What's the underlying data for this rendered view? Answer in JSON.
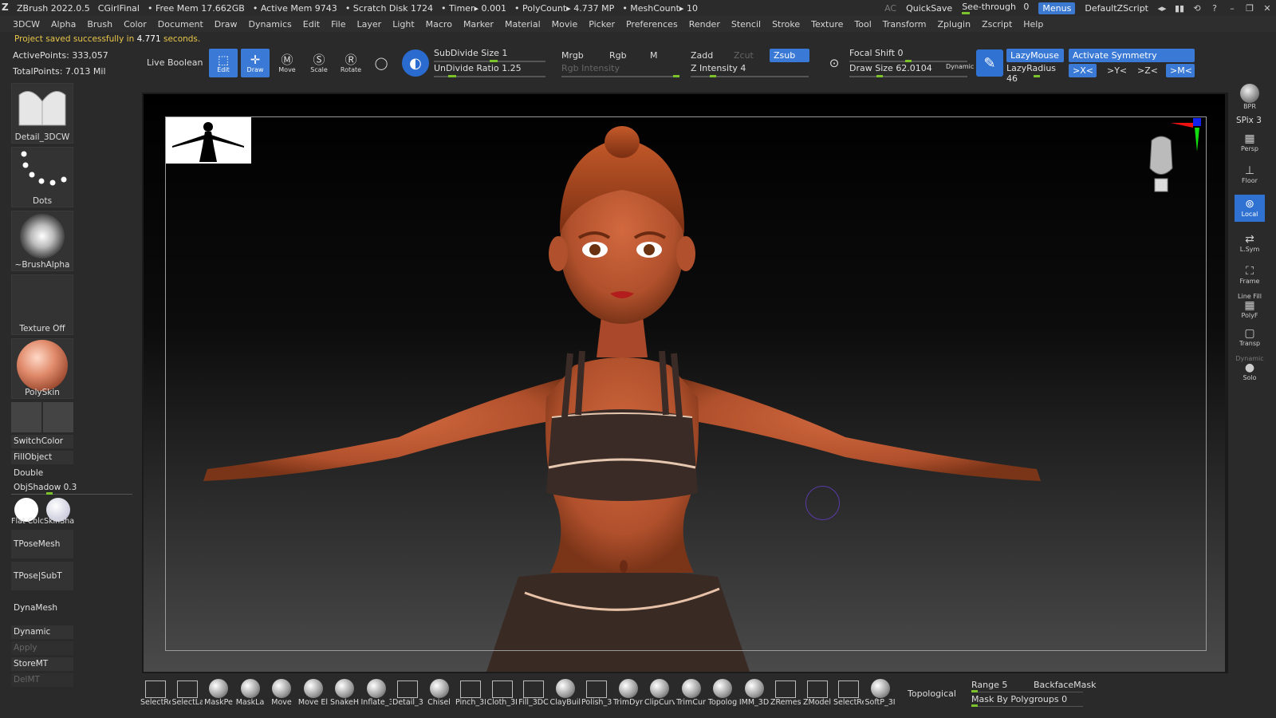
{
  "titlebar": {
    "app": "ZBrush 2022.0.5",
    "project": "CGirlFinal",
    "free_mem": "• Free Mem 17.662GB",
    "active_mem": "• Active Mem 9743",
    "scratch": "• Scratch Disk 1724",
    "timer": "• Timer▸ 0.001",
    "polycount": "• PolyCount▸ 4.737 MP",
    "meshcount": "• MeshCount▸ 10",
    "ac": "AC",
    "quicksave": "QuickSave",
    "see_through_label": "See-through",
    "see_through_value": "0",
    "menus": "Menus",
    "script": "DefaultZScript"
  },
  "menubar": [
    "3DCW",
    "Alpha",
    "Brush",
    "Color",
    "Document",
    "Draw",
    "Dynamics",
    "Edit",
    "File",
    "Layer",
    "Light",
    "Macro",
    "Marker",
    "Material",
    "Movie",
    "Picker",
    "Preferences",
    "Render",
    "Stencil",
    "Stroke",
    "Texture",
    "Tool",
    "Transform",
    "Zplugin",
    "Zscript",
    "Help"
  ],
  "notice": {
    "prefix": "Project saved successfully in",
    "value": "4.771",
    "suffix": "seconds."
  },
  "stats": {
    "active_points": "ActivePoints: 333,057",
    "total_points": "TotalPoints: 7.013 Mil"
  },
  "shelf": {
    "live_boolean": "Live Boolean",
    "edit": "Edit",
    "draw": "Draw",
    "move": "Move",
    "scale": "Scale",
    "rotate": "Rotate",
    "subdivide_label": "SubDivide Size",
    "subdivide_value": "1",
    "undivide_label": "UnDivide Ratio",
    "undivide_value": "1.25",
    "mrgb": "Mrgb",
    "rgb": "Rgb",
    "m": "M",
    "rgb_intensity": "Rgb Intensity",
    "zadd": "Zadd",
    "zcut": "Zcut",
    "zsub": "Zsub",
    "z_intensity_label": "Z Intensity",
    "z_intensity_value": "4",
    "focal_shift_label": "Focal Shift",
    "focal_shift_value": "0",
    "draw_size_label": "Draw Size",
    "draw_size_value": "62.0104",
    "dynamic": "Dynamic",
    "lazy_mouse": "LazyMouse",
    "lazy_radius_label": "LazyRadius",
    "lazy_radius_value": "46",
    "activate_symmetry": "Activate Symmetry",
    "sym_x": ">X<",
    "sym_y": ">Y<",
    "sym_z": ">Z<",
    "sym_m": ">M<"
  },
  "left": {
    "detail_3dcw": "Detail_3DCW",
    "dots": "Dots",
    "brush_alpha": "~BrushAlpha",
    "texture_off": "Texture Off",
    "polyskin": "PolySkin",
    "switch_color": "SwitchColor",
    "fill_object": "FillObject",
    "double": "Double",
    "obj_shadow_label": "ObjShadow",
    "obj_shadow_value": "0.3",
    "flat_color": "Flat Colc",
    "skin_shade": "SkinSha",
    "tpose_mesh": "TPoseMesh",
    "tpose_subt": "TPose|SubT",
    "dynamesh": "DynaMesh",
    "dynamic": "Dynamic",
    "apply": "Apply",
    "store_mt": "StoreMT",
    "del_mt": "DelMT"
  },
  "right": {
    "bpr": "BPR",
    "spix_label": "SPix",
    "spix_value": "3",
    "persp": "Persp",
    "floor": "Floor",
    "local": "Local",
    "lsym": "L.Sym",
    "frame": "Frame",
    "line_fill": "Line Fill",
    "polyf": "PolyF",
    "transp": "Transp",
    "dynamic": "Dynamic",
    "solo": "Solo"
  },
  "bottom": {
    "brushes": [
      "SelectRe",
      "SelectLa",
      "MaskPe",
      "MaskLa",
      "Move",
      "Move El",
      "SnakeH",
      "Inflate_3",
      "Detail_3",
      "Chisel",
      "Pinch_3I",
      "Cloth_3I",
      "Fill_3DC",
      "ClayBuil",
      "Polish_3",
      "TrimDyr",
      "ClipCurv",
      "TrimCur",
      "Topolog",
      "IMM_3D",
      "ZRemes",
      "ZModel",
      "SelectRe",
      "SoftP_3I"
    ],
    "topological": "Topological",
    "range_label": "Range",
    "range_value": "5",
    "backface_mask": "BackfaceMask",
    "mask_by_polygroups_label": "Mask By Polygroups",
    "mask_by_polygroups_value": "0"
  },
  "colors": {
    "accent": "#3a7ad6",
    "slider": "#7cc22a",
    "notice": "#e8c64a",
    "skin": "#c8613a"
  }
}
